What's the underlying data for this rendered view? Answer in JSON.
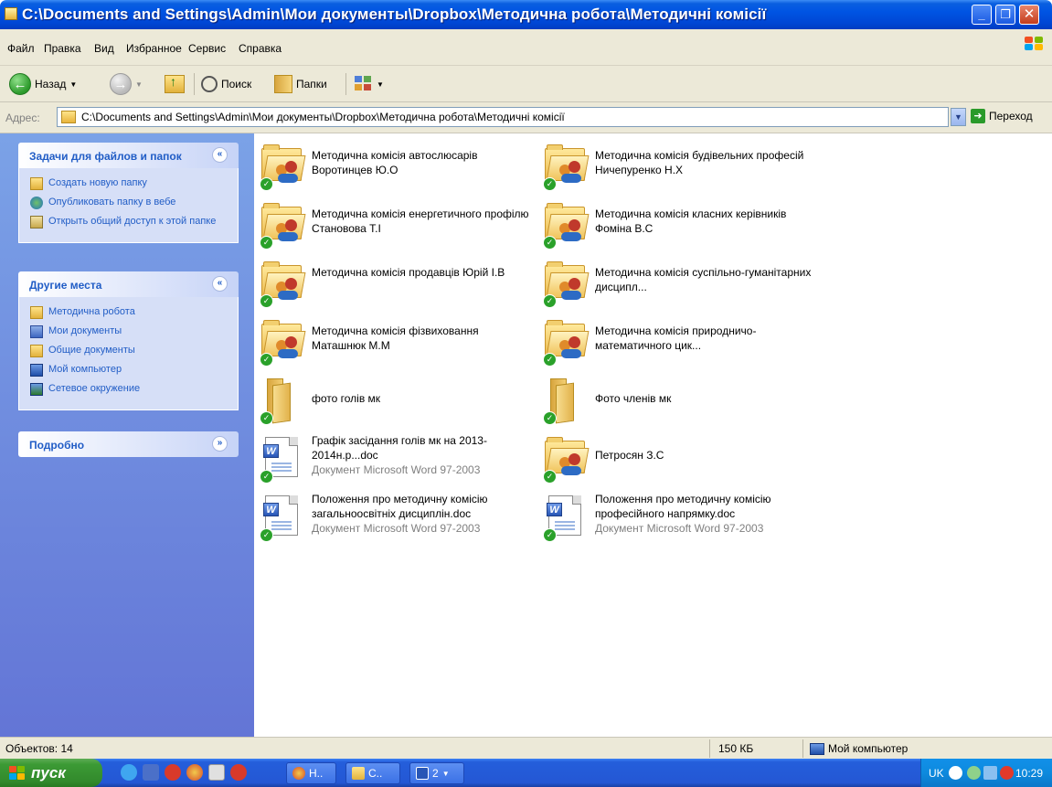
{
  "window": {
    "title": "C:\\Documents and Settings\\Admin\\Мои документы\\Dropbox\\Методична робота\\Методичні комісії",
    "minimize": "_",
    "maximize": "❐",
    "close": "✕"
  },
  "menu": [
    "Файл",
    "Правка",
    "Вид",
    "Избранное",
    "Сервис",
    "Справка"
  ],
  "toolbar": {
    "back_label": "Назад",
    "search_label": "Поиск",
    "folders_label": "Папки"
  },
  "address": {
    "label": "Адрес:",
    "value": "C:\\Documents and Settings\\Admin\\Мои документы\\Dropbox\\Методична робота\\Методичні комісії",
    "go_label": "Переход"
  },
  "left_pane": {
    "tasks_panel": {
      "title": "Задачи для файлов и папок",
      "items": [
        "Создать новую папку",
        "Опубликовать папку в вебе",
        "Открыть общий доступ к этой папке"
      ]
    },
    "places_panel": {
      "title": "Другие места",
      "items": [
        "Методична робота",
        "Мои документы",
        "Общие документы",
        "Мой компьютер",
        "Сетевое окружение"
      ]
    },
    "details_panel": {
      "title": "Подробно"
    }
  },
  "files": [
    {
      "name": "Методична комісія автослюсарів Воротинцев Ю.О",
      "type": "shared-folder"
    },
    {
      "name": "Методична комісія будівельних професій Ничепуренко Н.Х",
      "type": "shared-folder"
    },
    {
      "name": "Методична комісія енергетичного профілю Становова Т.І",
      "type": "shared-folder"
    },
    {
      "name": "Методична комісія класних керівників Фоміна В.С",
      "type": "shared-folder"
    },
    {
      "name": "Методична комісія продавців Юрій І.В",
      "type": "shared-folder"
    },
    {
      "name": "Методична комісія суспільно-гуманітарних дисципл...",
      "type": "shared-folder"
    },
    {
      "name": "Методична комісія фізвиховання Маташнюк М.М",
      "type": "shared-folder"
    },
    {
      "name": "Методична комісія природничо-математичного цик...",
      "type": "shared-folder"
    },
    {
      "name": "фото голів мк",
      "type": "folder"
    },
    {
      "name": "Фото членів мк",
      "type": "folder"
    },
    {
      "name": "Графік засідання голів мк на 2013-2014н.р...doc",
      "type": "word-doc",
      "sub": "Документ Microsoft Word 97-2003"
    },
    {
      "name": "Петросян З.С",
      "type": "shared-folder"
    },
    {
      "name": "Положення про методичну комісію загальноосвітніх дисциплін.doc",
      "type": "word-doc",
      "sub": "Документ Microsoft Word 97-2003"
    },
    {
      "name": "Положення про методичну комісію професійного напрямку.doc",
      "type": "word-doc",
      "sub": "Документ Microsoft Word 97-2003"
    }
  ],
  "status": {
    "objects": "Объектов: 14",
    "size": "150 КБ",
    "location": "Мой компьютер"
  },
  "taskbar": {
    "start_label": "пуск",
    "buttons": [
      "Н..",
      "C..",
      "2"
    ],
    "lang": "UK",
    "clock": "10:29"
  }
}
